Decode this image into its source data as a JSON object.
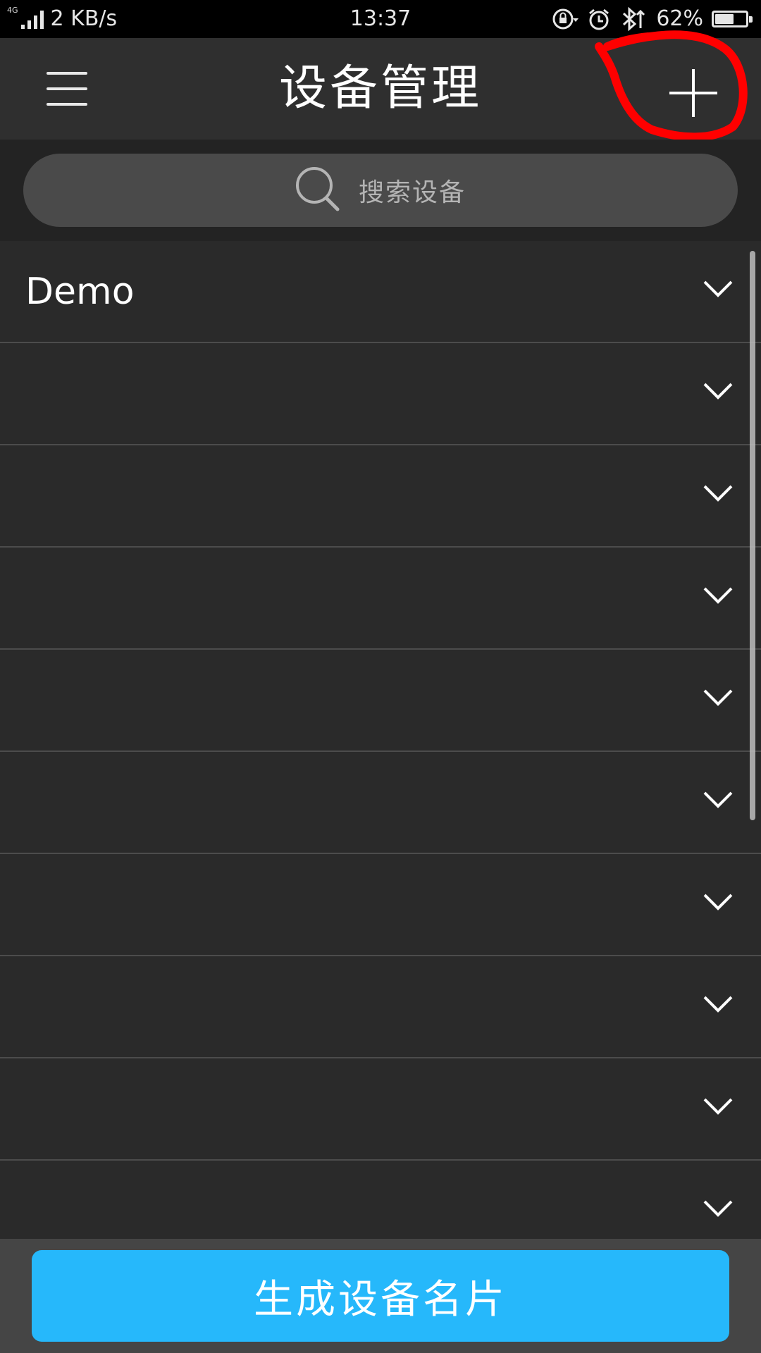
{
  "status_bar": {
    "network_tag": "4G",
    "net_speed": "2 KB/s",
    "time": "13:37",
    "battery_percent": "62%",
    "battery_level": 0.62,
    "icons": [
      "rotation-lock-icon",
      "alarm-icon",
      "bluetooth-icon"
    ]
  },
  "header": {
    "title": "设备管理",
    "menu_icon": "hamburger-menu-icon",
    "add_icon": "plus-icon",
    "annotation_color": "#ff0000"
  },
  "search": {
    "placeholder": "搜索设备",
    "icon": "search-icon"
  },
  "devices": [
    {
      "name": "Demo"
    },
    {
      "name": ""
    },
    {
      "name": ""
    },
    {
      "name": ""
    },
    {
      "name": ""
    },
    {
      "name": ""
    },
    {
      "name": ""
    },
    {
      "name": ""
    },
    {
      "name": ""
    },
    {
      "name": ""
    }
  ],
  "bottom": {
    "button_label": "生成设备名片"
  },
  "colors": {
    "accent": "#26b8fb",
    "background": "#2a2a2a",
    "header": "#2f2f2f"
  }
}
